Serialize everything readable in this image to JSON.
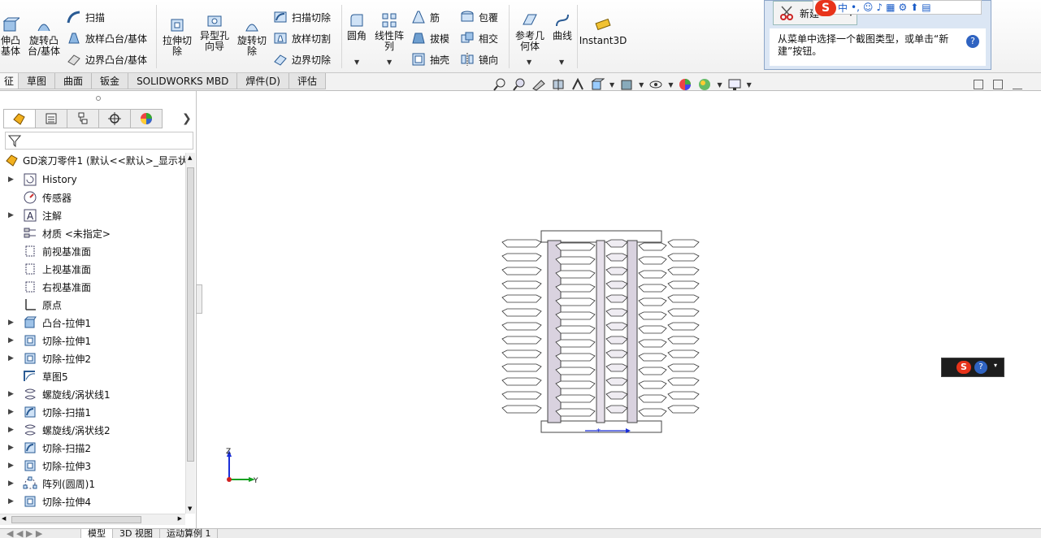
{
  "ribbon": {
    "col1": [
      "伸凸",
      "基体"
    ],
    "col2": [
      "旋转凸",
      "台/基体"
    ],
    "sweep": "扫描",
    "loft_boss": "放样凸台/基体",
    "boundary_boss": "边界凸台/基体",
    "extrude_cut": [
      "拉伸切",
      "除"
    ],
    "hole_wizard": [
      "异型孔",
      "向导"
    ],
    "revolve_cut": [
      "旋转切",
      "除"
    ],
    "sweep_cut": "扫描切除",
    "loft_cut": "放样切割",
    "boundary_cut": "边界切除",
    "fillet": "圆角",
    "linear_pattern": [
      "线性阵",
      "列"
    ],
    "rib": "筋",
    "draft": "拔模",
    "shell": "抽壳",
    "wrap": "包覆",
    "intersect": "相交",
    "mirror": "镜向",
    "ref_geometry": [
      "参考几",
      "何体"
    ],
    "curves": "曲线",
    "instant3d": "Instant3D"
  },
  "tabs": [
    "征",
    "草图",
    "曲面",
    "钣金",
    "SOLIDWORKS MBD",
    "焊件(D)",
    "评估"
  ],
  "popup": {
    "new_label": "新建",
    "message": "从菜单中选择一个截图类型，或单击“新建”按钮。",
    "help": "?"
  },
  "ime": {
    "logo": "S",
    "mode": "中"
  },
  "mini": {
    "logo": "S",
    "help": "?"
  },
  "tree": {
    "root": "GD滚刀零件1  (默认<<默认>_显示状",
    "items": [
      {
        "label": "History",
        "exp": true,
        "icon": "history-icon"
      },
      {
        "label": "传感器",
        "exp": false,
        "icon": "sensor-icon"
      },
      {
        "label": "注解",
        "exp": true,
        "icon": "annotation-icon"
      },
      {
        "label": "材质 <未指定>",
        "exp": false,
        "icon": "material-icon"
      },
      {
        "label": "前视基准面",
        "exp": false,
        "icon": "plane-icon"
      },
      {
        "label": "上视基准面",
        "exp": false,
        "icon": "plane-icon"
      },
      {
        "label": "右视基准面",
        "exp": false,
        "icon": "plane-icon"
      },
      {
        "label": "原点",
        "exp": false,
        "icon": "origin-icon"
      },
      {
        "label": "凸台-拉伸1",
        "exp": true,
        "icon": "boss-extrude-icon"
      },
      {
        "label": "切除-拉伸1",
        "exp": true,
        "icon": "cut-extrude-icon"
      },
      {
        "label": "切除-拉伸2",
        "exp": true,
        "icon": "cut-extrude-icon"
      },
      {
        "label": "草图5",
        "exp": false,
        "icon": "sketch-icon"
      },
      {
        "label": "螺旋线/涡状线1",
        "exp": true,
        "icon": "helix-icon"
      },
      {
        "label": "切除-扫描1",
        "exp": true,
        "icon": "cut-sweep-icon"
      },
      {
        "label": "螺旋线/涡状线2",
        "exp": true,
        "icon": "helix-icon"
      },
      {
        "label": "切除-扫描2",
        "exp": true,
        "icon": "cut-sweep-icon"
      },
      {
        "label": "切除-拉伸3",
        "exp": true,
        "icon": "cut-extrude-icon"
      },
      {
        "label": "阵列(圆周)1",
        "exp": true,
        "icon": "circular-pattern-icon"
      },
      {
        "label": "切除-拉伸4",
        "exp": true,
        "icon": "cut-extrude-icon"
      }
    ]
  },
  "triad": {
    "z": "Z",
    "y": "Y"
  },
  "bottom_tabs": [
    "模型",
    "3D 视图",
    "运动算例 1"
  ]
}
